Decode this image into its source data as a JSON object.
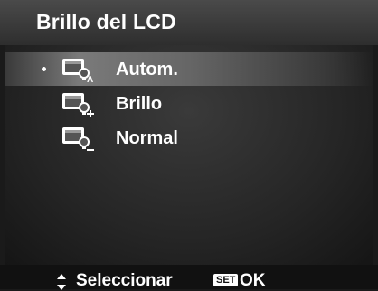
{
  "header": {
    "title": "Brillo del LCD"
  },
  "menu": {
    "items": [
      {
        "label": "Autom.",
        "icon": "lcd-brightness-auto-icon",
        "selected": true
      },
      {
        "label": "Brillo",
        "icon": "lcd-brightness-bright-icon",
        "selected": false
      },
      {
        "label": "Normal",
        "icon": "lcd-brightness-normal-icon",
        "selected": false
      }
    ]
  },
  "footer": {
    "select_label": "Seleccionar",
    "set_badge": "SET",
    "ok_label": "OK",
    "navigate_icon": "up-down-arrows-icon"
  },
  "colors": {
    "background": "#1a1a1a",
    "header": "#3a3a3a",
    "text": "#ffffff"
  }
}
